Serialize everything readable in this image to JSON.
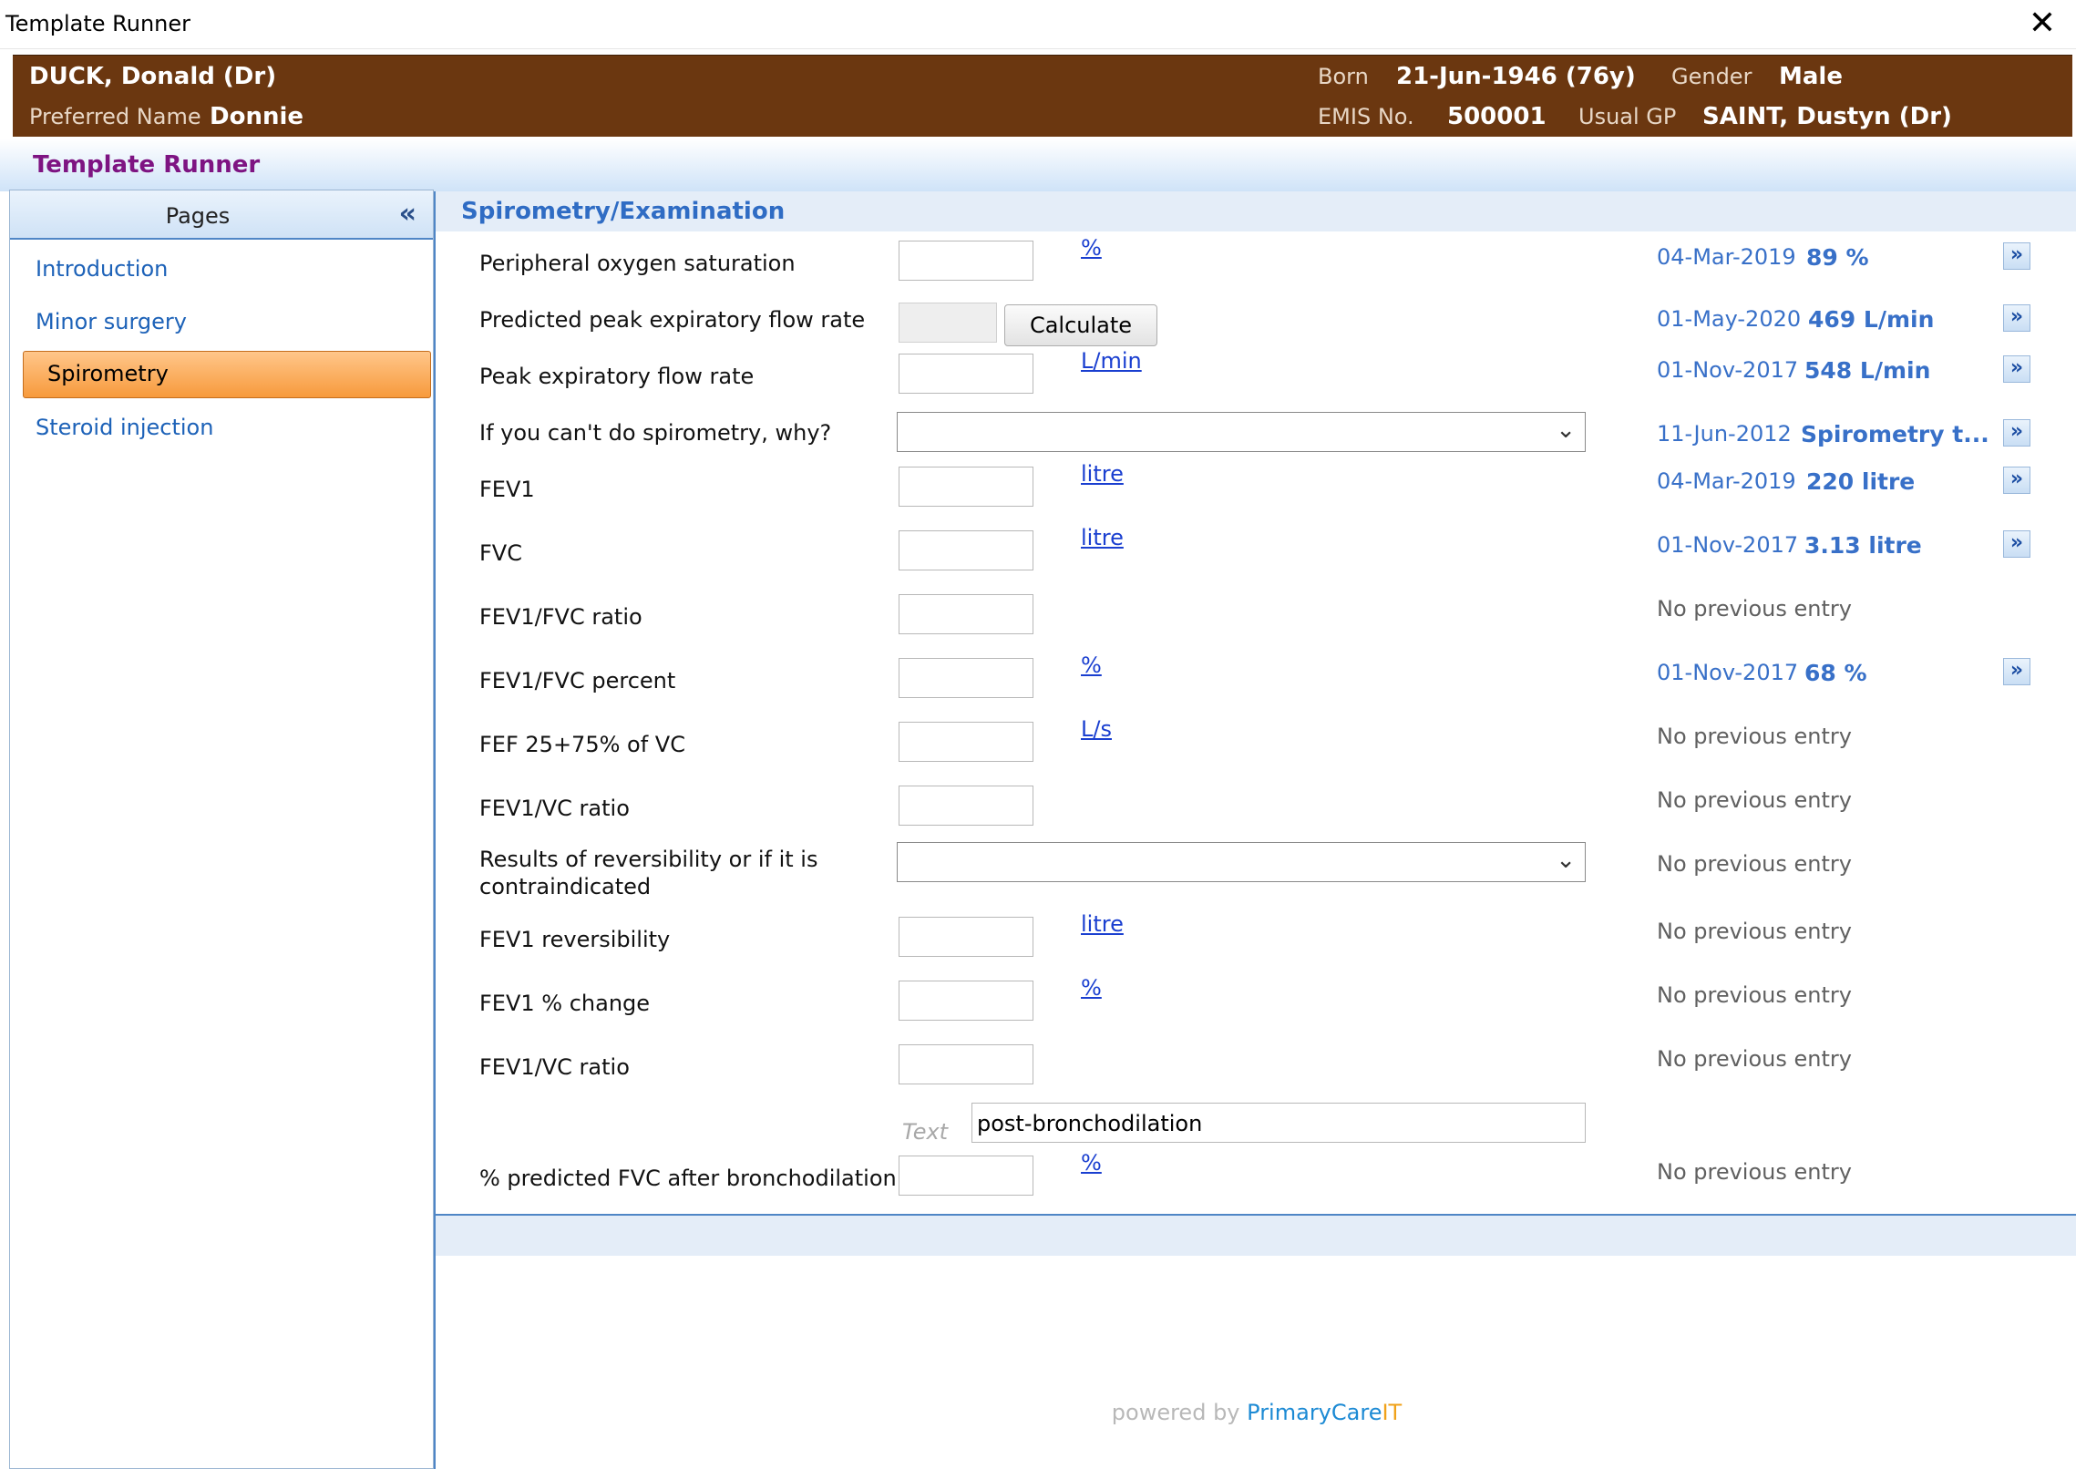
{
  "window": {
    "title": "Template Runner",
    "close_glyph": "✕"
  },
  "patient": {
    "name": "DUCK, Donald (Dr)",
    "preferred_label": "Preferred Name",
    "preferred_value": "Donnie",
    "born_label": "Born",
    "born_value": "21-Jun-1946 (76y)",
    "gender_label": "Gender",
    "gender_value": "Male",
    "emis_label": "EMIS No.",
    "emis_value": "500001",
    "gp_label": "Usual GP",
    "gp_value": "SAINT, Dustyn (Dr)"
  },
  "app": {
    "header": "Template Runner"
  },
  "pages": {
    "title": "Pages",
    "collapse_glyph": "«",
    "items": [
      {
        "label": "Introduction",
        "selected": false
      },
      {
        "label": "Minor surgery",
        "selected": false
      },
      {
        "label": "Spirometry",
        "selected": true
      },
      {
        "label": "Steroid injection",
        "selected": false
      }
    ]
  },
  "section": {
    "title": "Spirometry/Examination"
  },
  "form": {
    "calculate_label": "Calculate",
    "text_label": "Text",
    "text_value": "post-bronchodilation",
    "no_prev": "No previous entry",
    "arrow_glyph": "»",
    "dropdown_glyph": "⌄",
    "rows": [
      {
        "label": "Peripheral oxygen saturation",
        "unit": "%",
        "prev_date": "04-Mar-2019",
        "prev_value": "89 %"
      },
      {
        "label": "Predicted peak expiratory flow rate",
        "prev_date": "01-May-2020",
        "prev_value": "469 L/min"
      },
      {
        "label": "Peak expiratory flow rate",
        "unit": "L/min",
        "prev_date": "01-Nov-2017",
        "prev_value": "548 L/min"
      },
      {
        "label": "If you can't do spirometry, why?",
        "prev_date": "11-Jun-2012",
        "prev_value": "Spirometry t..."
      },
      {
        "label": "FEV1",
        "unit": "litre",
        "prev_date": "04-Mar-2019",
        "prev_value": "220 litre"
      },
      {
        "label": "FVC",
        "unit": "litre",
        "prev_date": "01-Nov-2017",
        "prev_value": "3.13 litre"
      },
      {
        "label": "FEV1/FVC ratio"
      },
      {
        "label": "FEV1/FVC percent",
        "unit": "%",
        "prev_date": "01-Nov-2017",
        "prev_value": "68 %"
      },
      {
        "label": "FEF 25+75% of VC",
        "unit": "L/s"
      },
      {
        "label": "FEV1/VC ratio"
      },
      {
        "label": "Results of reversibility or if it is",
        "label2": "contraindicated"
      },
      {
        "label": "FEV1 reversibility",
        "unit": "litre"
      },
      {
        "label": "FEV1 % change",
        "unit": "%"
      },
      {
        "label": "FEV1/VC ratio"
      },
      {
        "label": "% predicted FVC after bronchodilation",
        "unit": "%"
      }
    ]
  },
  "footer": {
    "powered_by": "powered by ",
    "brand_primary": "PrimaryCare",
    "brand_it": "IT"
  }
}
